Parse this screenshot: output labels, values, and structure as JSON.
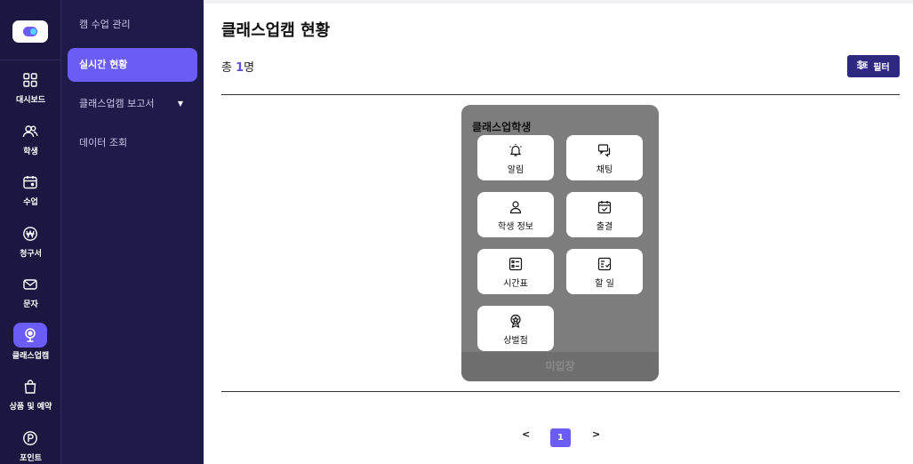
{
  "rail": {
    "items": [
      {
        "label": "대시보드",
        "icon": "grid-icon"
      },
      {
        "label": "학생",
        "icon": "users-icon"
      },
      {
        "label": "수업",
        "icon": "calendar-icon"
      },
      {
        "label": "청구서",
        "icon": "won-icon"
      },
      {
        "label": "문자",
        "icon": "mail-icon"
      },
      {
        "label": "클래스업캠",
        "icon": "webcam-icon"
      },
      {
        "label": "상품 및 예약",
        "icon": "bag-icon"
      },
      {
        "label": "포인트",
        "icon": "point-icon"
      }
    ],
    "active_index": 5
  },
  "submenu": {
    "items": [
      {
        "label": "캠 수업 관리"
      },
      {
        "label": "실시간 현황"
      },
      {
        "label": "클래스업캠 보고서"
      },
      {
        "label": "데이터 조회"
      }
    ],
    "active_index": 1
  },
  "header": {
    "title": "클래스업캠 현황",
    "count_prefix": "총 ",
    "count_value": "1",
    "count_suffix": "명",
    "filter_label": "필터"
  },
  "card": {
    "student_name": "클래스업학생",
    "status": "미입장",
    "actions": [
      {
        "label": "알림",
        "icon": "bell-icon"
      },
      {
        "label": "채팅",
        "icon": "chat-icon"
      },
      {
        "label": "학생 정보",
        "icon": "user-icon"
      },
      {
        "label": "출결",
        "icon": "calendar-check-icon"
      },
      {
        "label": "시간표",
        "icon": "schedule-list-icon"
      },
      {
        "label": "할 일",
        "icon": "checklist-icon"
      },
      {
        "label": "상벌점",
        "icon": "medal-icon"
      }
    ]
  },
  "pagination": {
    "prev": "<",
    "current": "1",
    "next": ">"
  },
  "colors": {
    "rail_bg": "#1b1740",
    "submenu_bg": "#1e1a49",
    "accent": "#6b5cf5",
    "filter_btn": "#2e2880",
    "card_bg": "#7d7d7d"
  }
}
